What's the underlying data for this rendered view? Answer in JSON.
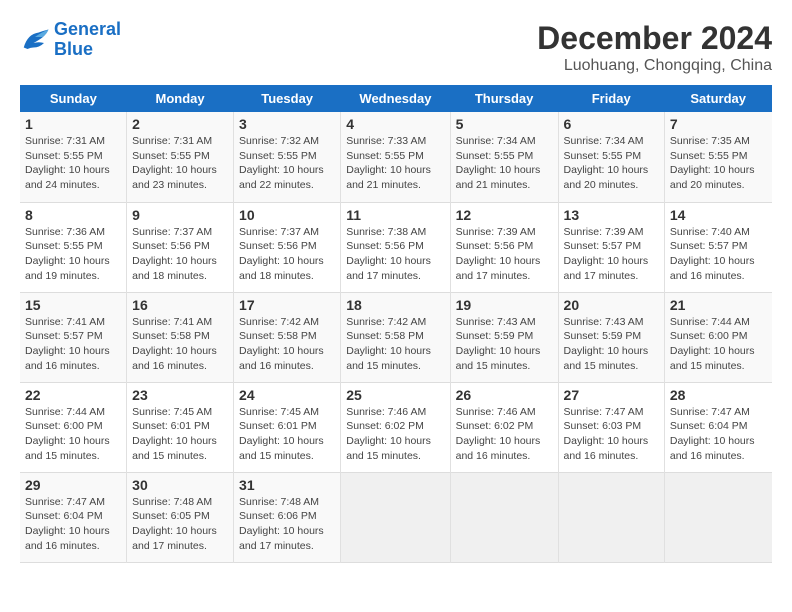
{
  "logo": {
    "line1": "General",
    "line2": "Blue"
  },
  "title": "December 2024",
  "location": "Luohuang, Chongqing, China",
  "weekdays": [
    "Sunday",
    "Monday",
    "Tuesday",
    "Wednesday",
    "Thursday",
    "Friday",
    "Saturday"
  ],
  "weeks": [
    [
      {
        "day": "1",
        "info": "Sunrise: 7:31 AM\nSunset: 5:55 PM\nDaylight: 10 hours\nand 24 minutes."
      },
      {
        "day": "2",
        "info": "Sunrise: 7:31 AM\nSunset: 5:55 PM\nDaylight: 10 hours\nand 23 minutes."
      },
      {
        "day": "3",
        "info": "Sunrise: 7:32 AM\nSunset: 5:55 PM\nDaylight: 10 hours\nand 22 minutes."
      },
      {
        "day": "4",
        "info": "Sunrise: 7:33 AM\nSunset: 5:55 PM\nDaylight: 10 hours\nand 21 minutes."
      },
      {
        "day": "5",
        "info": "Sunrise: 7:34 AM\nSunset: 5:55 PM\nDaylight: 10 hours\nand 21 minutes."
      },
      {
        "day": "6",
        "info": "Sunrise: 7:34 AM\nSunset: 5:55 PM\nDaylight: 10 hours\nand 20 minutes."
      },
      {
        "day": "7",
        "info": "Sunrise: 7:35 AM\nSunset: 5:55 PM\nDaylight: 10 hours\nand 20 minutes."
      }
    ],
    [
      {
        "day": "8",
        "info": "Sunrise: 7:36 AM\nSunset: 5:55 PM\nDaylight: 10 hours\nand 19 minutes."
      },
      {
        "day": "9",
        "info": "Sunrise: 7:37 AM\nSunset: 5:56 PM\nDaylight: 10 hours\nand 18 minutes."
      },
      {
        "day": "10",
        "info": "Sunrise: 7:37 AM\nSunset: 5:56 PM\nDaylight: 10 hours\nand 18 minutes."
      },
      {
        "day": "11",
        "info": "Sunrise: 7:38 AM\nSunset: 5:56 PM\nDaylight: 10 hours\nand 17 minutes."
      },
      {
        "day": "12",
        "info": "Sunrise: 7:39 AM\nSunset: 5:56 PM\nDaylight: 10 hours\nand 17 minutes."
      },
      {
        "day": "13",
        "info": "Sunrise: 7:39 AM\nSunset: 5:57 PM\nDaylight: 10 hours\nand 17 minutes."
      },
      {
        "day": "14",
        "info": "Sunrise: 7:40 AM\nSunset: 5:57 PM\nDaylight: 10 hours\nand 16 minutes."
      }
    ],
    [
      {
        "day": "15",
        "info": "Sunrise: 7:41 AM\nSunset: 5:57 PM\nDaylight: 10 hours\nand 16 minutes."
      },
      {
        "day": "16",
        "info": "Sunrise: 7:41 AM\nSunset: 5:58 PM\nDaylight: 10 hours\nand 16 minutes."
      },
      {
        "day": "17",
        "info": "Sunrise: 7:42 AM\nSunset: 5:58 PM\nDaylight: 10 hours\nand 16 minutes."
      },
      {
        "day": "18",
        "info": "Sunrise: 7:42 AM\nSunset: 5:58 PM\nDaylight: 10 hours\nand 15 minutes."
      },
      {
        "day": "19",
        "info": "Sunrise: 7:43 AM\nSunset: 5:59 PM\nDaylight: 10 hours\nand 15 minutes."
      },
      {
        "day": "20",
        "info": "Sunrise: 7:43 AM\nSunset: 5:59 PM\nDaylight: 10 hours\nand 15 minutes."
      },
      {
        "day": "21",
        "info": "Sunrise: 7:44 AM\nSunset: 6:00 PM\nDaylight: 10 hours\nand 15 minutes."
      }
    ],
    [
      {
        "day": "22",
        "info": "Sunrise: 7:44 AM\nSunset: 6:00 PM\nDaylight: 10 hours\nand 15 minutes."
      },
      {
        "day": "23",
        "info": "Sunrise: 7:45 AM\nSunset: 6:01 PM\nDaylight: 10 hours\nand 15 minutes."
      },
      {
        "day": "24",
        "info": "Sunrise: 7:45 AM\nSunset: 6:01 PM\nDaylight: 10 hours\nand 15 minutes."
      },
      {
        "day": "25",
        "info": "Sunrise: 7:46 AM\nSunset: 6:02 PM\nDaylight: 10 hours\nand 15 minutes."
      },
      {
        "day": "26",
        "info": "Sunrise: 7:46 AM\nSunset: 6:02 PM\nDaylight: 10 hours\nand 16 minutes."
      },
      {
        "day": "27",
        "info": "Sunrise: 7:47 AM\nSunset: 6:03 PM\nDaylight: 10 hours\nand 16 minutes."
      },
      {
        "day": "28",
        "info": "Sunrise: 7:47 AM\nSunset: 6:04 PM\nDaylight: 10 hours\nand 16 minutes."
      }
    ],
    [
      {
        "day": "29",
        "info": "Sunrise: 7:47 AM\nSunset: 6:04 PM\nDaylight: 10 hours\nand 16 minutes."
      },
      {
        "day": "30",
        "info": "Sunrise: 7:48 AM\nSunset: 6:05 PM\nDaylight: 10 hours\nand 17 minutes."
      },
      {
        "day": "31",
        "info": "Sunrise: 7:48 AM\nSunset: 6:06 PM\nDaylight: 10 hours\nand 17 minutes."
      },
      {
        "day": "",
        "info": ""
      },
      {
        "day": "",
        "info": ""
      },
      {
        "day": "",
        "info": ""
      },
      {
        "day": "",
        "info": ""
      }
    ]
  ]
}
